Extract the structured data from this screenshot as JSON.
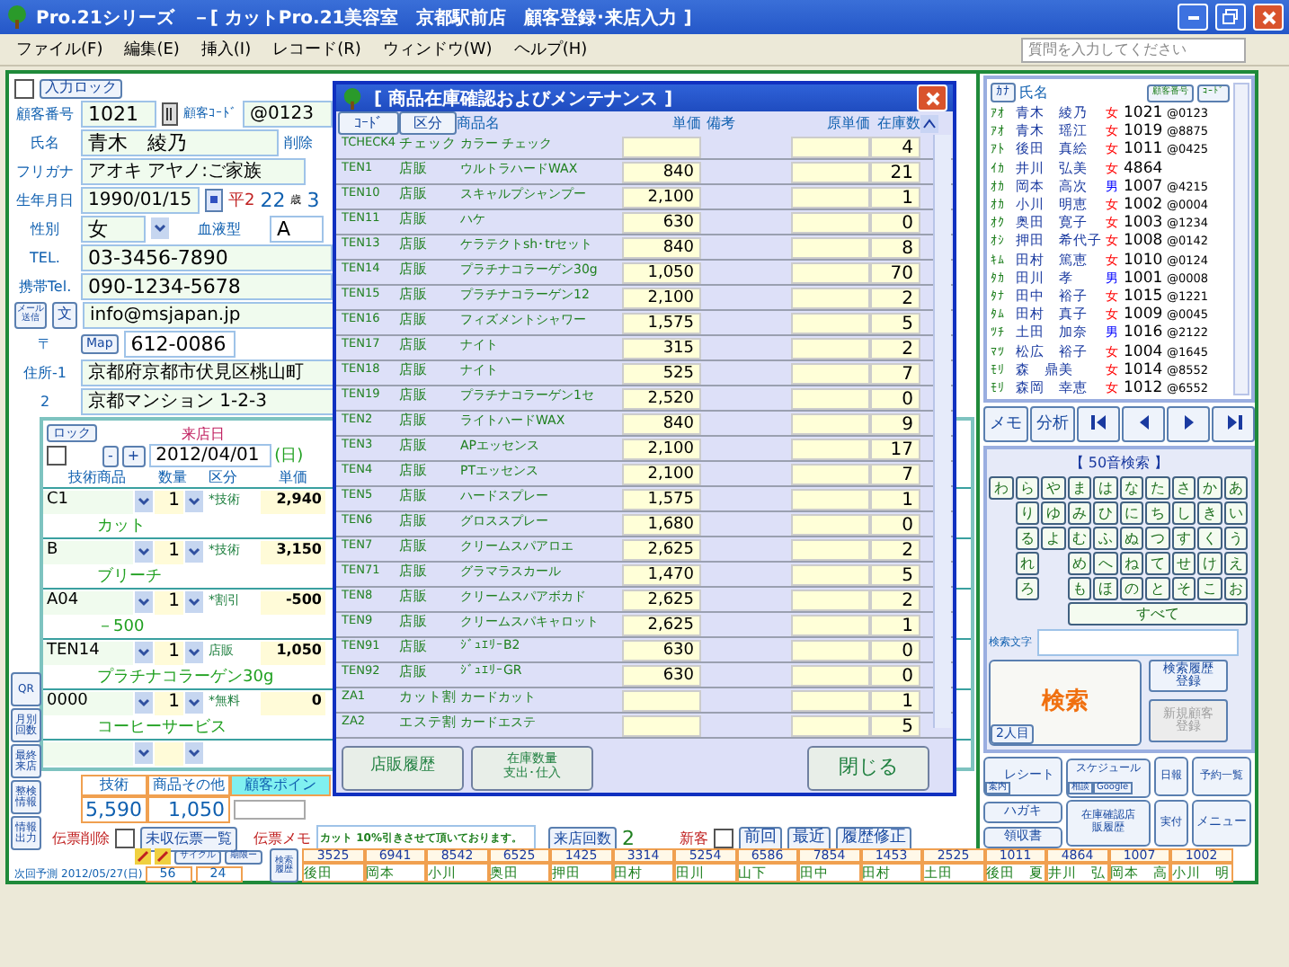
{
  "window": {
    "title": "Pro.21シリーズ　－[ カットPro.21美容室　京都駅前店　顧客登録･来店入力 ]"
  },
  "menu": [
    "ファイル(F)",
    "編集(E)",
    "挿入(I)",
    "レコード(R)",
    "ウィンドウ(W)",
    "ヘルプ(H)"
  ],
  "help_search": {
    "placeholder": "質問を入力してください"
  },
  "customer_form": {
    "input_lock": {
      "label": "入力ロック",
      "checked": false
    },
    "customer_number": {
      "label": "顧客番号",
      "value": "1021"
    },
    "customer_code": {
      "label": "顧客ｺｰﾄﾞ",
      "value": "@0123"
    },
    "name": {
      "label": "氏名",
      "value": "青木　綾乃",
      "delete_label": "削除"
    },
    "furigana": {
      "label": "フリガナ",
      "value": "アオキ アヤノ:ご家族"
    },
    "birthday": {
      "label": "生年月日",
      "value": "1990/01/15",
      "era": "平2",
      "age": "22",
      "age_unit": "歳",
      "month": "3"
    },
    "gender": {
      "label": "性別",
      "value": "女"
    },
    "blood_type": {
      "label": "血液型",
      "value": "A"
    },
    "tel": {
      "label": "TEL.",
      "value": "03-3456-7890"
    },
    "mobile": {
      "label": "携帯Tel.",
      "value": "090-1234-5678"
    },
    "mail": {
      "send_button": "メール送信",
      "text_button": "文",
      "value": "info@msjapan.jp"
    },
    "postal": {
      "label": "〒",
      "map_button": "Map",
      "value": "612-0086"
    },
    "address1": {
      "label": "住所-1",
      "value": "京都府京都市伏見区桃山町"
    },
    "address2": {
      "label": "2",
      "value": "京都マンション 1-2-3"
    }
  },
  "visit": {
    "lock": {
      "label": "ロック",
      "checked": false
    },
    "date_label": "来店日",
    "minus": "-",
    "plus": "+",
    "date": "2012/04/01",
    "weekday": "(日)",
    "columns": [
      "技術商品",
      "数量",
      "区分",
      "単価"
    ],
    "items": [
      {
        "code": "C1",
        "qty": "1",
        "category": "*技術",
        "price": "2,940",
        "name": "カット"
      },
      {
        "code": "B",
        "qty": "1",
        "category": "*技術",
        "price": "3,150",
        "name": "ブリーチ"
      },
      {
        "code": "A04",
        "qty": "1",
        "category": "*割引",
        "price": "-500",
        "name": "－500"
      },
      {
        "code": "TEN14",
        "qty": "1",
        "category": "店販",
        "price": "1,050",
        "name": "プラチナコラーゲン30g"
      },
      {
        "code": "0000",
        "qty": "1",
        "category": "*無料",
        "price": "0",
        "name": "コーヒーサービス"
      }
    ]
  },
  "side_buttons": [
    "QR",
    "月別回数",
    "最終来店",
    "整検情報",
    "情報出力"
  ],
  "totals": {
    "labels": [
      "技術",
      "商品その他",
      "顧客ポイン"
    ],
    "values": [
      "5,590",
      "1,050"
    ]
  },
  "slip": {
    "delete": {
      "label": "伝票削除",
      "checked": false
    },
    "unpaid_button": "未収伝票一覧",
    "memo_label": "伝票メモ",
    "memo": "カット 10%引きさせて頂いております。",
    "visits_button": "来店回数",
    "visits": "2",
    "new_customer": {
      "label": "新客",
      "checked": false
    },
    "buttons": [
      "前回",
      "最近",
      "履歴修正"
    ]
  },
  "next_visit": {
    "cycle_button": "サイクル",
    "limit_button": "期限ー",
    "label": "次回予測",
    "date": "2012/05/27(日)",
    "values": [
      "56",
      "24"
    ],
    "search_history_button": "検索履歴"
  },
  "history": [
    {
      "number": "3525",
      "name": "後田"
    },
    {
      "number": "6941",
      "name": "岡本"
    },
    {
      "number": "8542",
      "name": "小川"
    },
    {
      "number": "6525",
      "name": "奥田"
    },
    {
      "number": "1425",
      "name": "押田"
    },
    {
      "number": "3314",
      "name": "田村"
    },
    {
      "number": "5254",
      "name": "田川"
    },
    {
      "number": "6586",
      "name": "山下"
    },
    {
      "number": "7854",
      "name": "田中"
    },
    {
      "number": "1453",
      "name": "田村"
    },
    {
      "number": "2525",
      "name": "土田"
    },
    {
      "number": "1011",
      "name": "後田　夏"
    },
    {
      "number": "4864",
      "name": "井川　弘"
    },
    {
      "number": "1007",
      "name": "岡本　高"
    },
    {
      "number": "1002",
      "name": "小川　明"
    }
  ],
  "inventory_dialog": {
    "title": "[ 商品在庫確認およびメンテナンス ]",
    "columns": {
      "code_button": "ｺｰﾄﾞ",
      "category_button": "区分",
      "name": "商品名",
      "price": "単価",
      "remarks": "備考",
      "cost": "原単価",
      "stock": "在庫数"
    },
    "rows": [
      {
        "code": "TCHECK4",
        "category": "チェック",
        "name": "カラー チェック",
        "stock": "4"
      },
      {
        "code": "TEN1",
        "category": "店販",
        "name": "ウルトラハードWAX",
        "price": "840",
        "stock": "21"
      },
      {
        "code": "TEN10",
        "category": "店販",
        "name": "スキャルプシャンプー",
        "price": "2,100",
        "stock": "1"
      },
      {
        "code": "TEN11",
        "category": "店販",
        "name": "ハケ",
        "price": "630",
        "stock": "0"
      },
      {
        "code": "TEN13",
        "category": "店販",
        "name": "ケラテクトsh･trセット",
        "price": "840",
        "stock": "8"
      },
      {
        "code": "TEN14",
        "category": "店販",
        "name": "プラチナコラーゲン30g",
        "price": "1,050",
        "stock": "70"
      },
      {
        "code": "TEN15",
        "category": "店販",
        "name": "プラチナコラーゲン12",
        "price": "2,100",
        "stock": "2"
      },
      {
        "code": "TEN16",
        "category": "店販",
        "name": "フィズメントシャワー",
        "price": "1,575",
        "stock": "5"
      },
      {
        "code": "TEN17",
        "category": "店販",
        "name": "ナイト",
        "price": "315",
        "stock": "2"
      },
      {
        "code": "TEN18",
        "category": "店販",
        "name": "ナイト",
        "price": "525",
        "stock": "7"
      },
      {
        "code": "TEN19",
        "category": "店販",
        "name": "プラチナコラーゲン1セ",
        "price": "2,520",
        "stock": "0"
      },
      {
        "code": "TEN2",
        "category": "店販",
        "name": "ライトハードWAX",
        "price": "840",
        "stock": "9"
      },
      {
        "code": "TEN3",
        "category": "店販",
        "name": "APエッセンス",
        "price": "2,100",
        "stock": "17"
      },
      {
        "code": "TEN4",
        "category": "店販",
        "name": "PTエッセンス",
        "price": "2,100",
        "stock": "7"
      },
      {
        "code": "TEN5",
        "category": "店販",
        "name": "ハードスプレー",
        "price": "1,575",
        "stock": "1"
      },
      {
        "code": "TEN6",
        "category": "店販",
        "name": "グロススプレー",
        "price": "1,680",
        "stock": "0"
      },
      {
        "code": "TEN7",
        "category": "店販",
        "name": "クリームスパアロエ",
        "price": "2,625",
        "stock": "2"
      },
      {
        "code": "TEN71",
        "category": "店販",
        "name": "グラマラスカール",
        "price": "1,470",
        "stock": "5"
      },
      {
        "code": "TEN8",
        "category": "店販",
        "name": "クリームスパアボカド",
        "price": "2,625",
        "stock": "2"
      },
      {
        "code": "TEN9",
        "category": "店販",
        "name": "クリームスパキャロット",
        "price": "2,625",
        "stock": "1"
      },
      {
        "code": "TEN91",
        "category": "店販",
        "name": "ｼﾞｭｴﾘｰB2",
        "price": "630",
        "stock": "0"
      },
      {
        "code": "TEN92",
        "category": "店販",
        "name": "ｼﾞｭｴﾘｰGR",
        "price": "630",
        "stock": "0"
      },
      {
        "code": "ZA1",
        "category": "カット割",
        "name": "カードカット",
        "stock": "1"
      },
      {
        "code": "ZA2",
        "category": "エステ割",
        "name": "カードエステ",
        "stock": "5"
      }
    ],
    "buttons": [
      "店販履歴",
      "在庫数量支出･仕入",
      "閉じる"
    ]
  },
  "customer_list": {
    "columns": {
      "kana_button": "ｶﾅ",
      "name": "氏名",
      "number_button": "顧客番号",
      "code_button": "ｺｰﾄﾞ"
    },
    "rows": [
      {
        "kana": "ｱｵ",
        "name": "青木　綾乃",
        "sex": "女",
        "color": "#ff0000",
        "number": "1021",
        "code": "@0123"
      },
      {
        "kana": "ｱｵ",
        "name": "青木　瑶江",
        "sex": "女",
        "color": "#ff0000",
        "number": "1019",
        "code": "@8875"
      },
      {
        "kana": "ｱﾄ",
        "name": "後田　真絵",
        "sex": "女",
        "color": "#ff0000",
        "number": "1011",
        "code": "@0425"
      },
      {
        "kana": "ｲｶ",
        "name": "井川　弘美",
        "sex": "女",
        "color": "#ff0000",
        "number": "4864"
      },
      {
        "kana": "ｵｶ",
        "name": "岡本　高次",
        "sex": "男",
        "color": "#0000ff",
        "number": "1007",
        "code": "@4215"
      },
      {
        "kana": "ｵｶ",
        "name": "小川　明恵",
        "sex": "女",
        "color": "#ff0000",
        "number": "1002",
        "code": "@0004"
      },
      {
        "kana": "ｵｸ",
        "name": "奥田　寛子",
        "sex": "女",
        "color": "#ff0000",
        "number": "1003",
        "code": "@1234"
      },
      {
        "kana": "ｵｼ",
        "name": "押田　希代子",
        "sex": "女",
        "color": "#ff0000",
        "number": "1008",
        "code": "@0142"
      },
      {
        "kana": "ｷﾑ",
        "name": "田村　篤恵",
        "sex": "女",
        "color": "#ff0000",
        "number": "1010",
        "code": "@0124"
      },
      {
        "kana": "ﾀｶ",
        "name": "田川　孝",
        "sex": "男",
        "color": "#0000ff",
        "number": "1001",
        "code": "@0008"
      },
      {
        "kana": "ﾀﾅ",
        "name": "田中　裕子",
        "sex": "女",
        "color": "#ff0000",
        "number": "1015",
        "code": "@1221"
      },
      {
        "kana": "ﾀﾑ",
        "name": "田村　真子",
        "sex": "女",
        "color": "#ff0000",
        "number": "1009",
        "code": "@0045"
      },
      {
        "kana": "ﾂﾁ",
        "name": "土田　加奈",
        "sex": "男",
        "color": "#0000ff",
        "number": "1016",
        "code": "@2122"
      },
      {
        "kana": "ﾏﾂ",
        "name": "松広　裕子",
        "sex": "女",
        "color": "#ff0000",
        "number": "1004",
        "code": "@1645"
      },
      {
        "kana": "ﾓﾘ",
        "name": "森　鼎美",
        "sex": "女",
        "color": "#ff0000",
        "number": "1014",
        "code": "@8552"
      },
      {
        "kana": "ﾓﾘ",
        "name": "森岡　幸恵",
        "sex": "女",
        "color": "#ff0000",
        "number": "1012",
        "code": "@6552"
      }
    ]
  },
  "nav_buttons": [
    "メモ",
    "分析"
  ],
  "kana_search": {
    "title": "【 50音検索 】",
    "rows": [
      [
        "わ",
        "ら",
        "や",
        "ま",
        "は",
        "な",
        "た",
        "さ",
        "か",
        "あ"
      ],
      [
        null,
        "り",
        "ゆ",
        "み",
        "ひ",
        "に",
        "ち",
        "し",
        "き",
        "い"
      ],
      [
        null,
        "る",
        "よ",
        "む",
        "ふ",
        "ぬ",
        "つ",
        "す",
        "く",
        "う"
      ],
      [
        null,
        "れ",
        null,
        "め",
        "へ",
        "ね",
        "て",
        "せ",
        "け",
        "え"
      ],
      [
        null,
        "ろ",
        null,
        "も",
        "ほ",
        "の",
        "と",
        "そ",
        "こ",
        "お"
      ]
    ],
    "all_button": "すべて",
    "search_text_label": "検索文字",
    "search_button": "検索",
    "second_button": "2人目",
    "history_button": "検索履歴登録",
    "new_customer_button": {
      "label": "新規顧客登録",
      "disabled": true
    }
  },
  "tools": {
    "receipt": "レシート",
    "guide": "案内",
    "schedule": "スケジュール",
    "consult": "相談",
    "google": "Google",
    "daily": "日報",
    "reservations": "予約一覧",
    "postcard": "ハガキ",
    "stock": "在庫確認店販履歴",
    "payment": "実付",
    "menu": "メニュー",
    "invoice": "領収書"
  }
}
